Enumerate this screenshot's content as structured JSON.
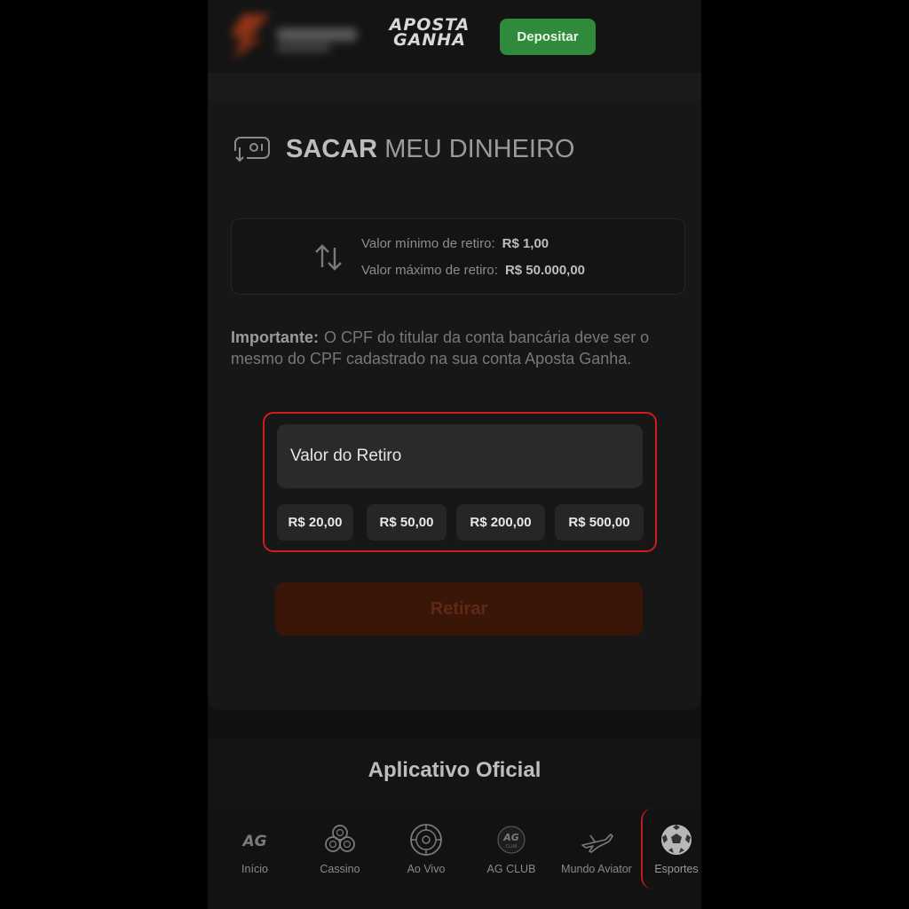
{
  "header": {
    "brand_line1": "APOSTA",
    "brand_line2": "GANHA",
    "deposit_label": "Depositar"
  },
  "withdraw": {
    "title_bold": "SACAR",
    "title_rest": "MEU DINHEIRO",
    "min_label": "Valor mínimo de retiro:",
    "min_value": "R$ 1,00",
    "max_label": "Valor máximo de retiro:",
    "max_value": "R$ 50.000,00",
    "notice_label": "Importante:",
    "notice_text": "O CPF do titular da conta bancária deve ser o mesmo do CPF cadastrado na sua conta Aposta Ganha.",
    "amount_placeholder": "Valor do Retiro",
    "chips": [
      "R$ 20,00",
      "R$ 50,00",
      "R$ 200,00",
      "R$ 500,00"
    ],
    "submit_label": "Retirar"
  },
  "app": {
    "title": "Aplicativo Oficial"
  },
  "nav": {
    "items": [
      {
        "label": "Início",
        "icon": "ag-logo-icon"
      },
      {
        "label": "Cassino",
        "icon": "casino-chips-icon"
      },
      {
        "label": "Ao Vivo",
        "icon": "roulette-icon"
      },
      {
        "label": "AG CLUB",
        "icon": "ag-club-icon"
      },
      {
        "label": "Mundo Aviator",
        "icon": "airplane-icon"
      },
      {
        "label": "Esportes",
        "icon": "soccer-ball-icon"
      }
    ],
    "active": "Esportes"
  },
  "colors": {
    "deposit_green": "#2f8a3c",
    "highlight_red": "#d01c1c",
    "withdraw_disabled": "#3a1609"
  }
}
